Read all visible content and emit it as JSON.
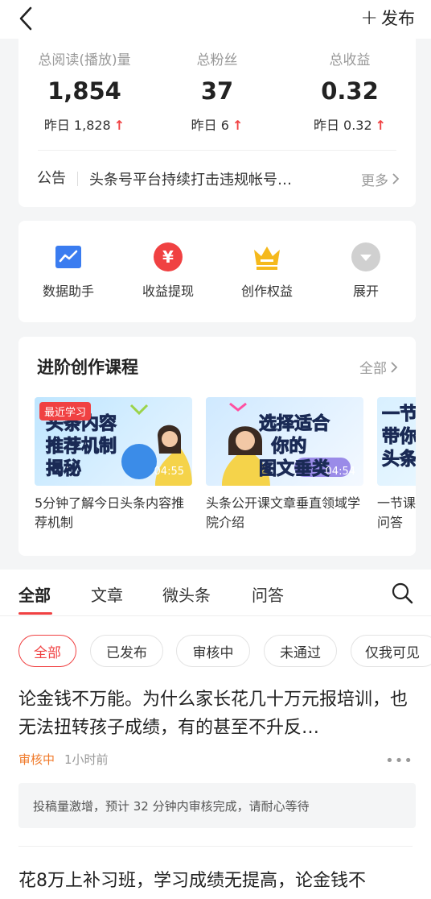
{
  "header": {
    "publish_label": "发布"
  },
  "stats": [
    {
      "label": "总阅读(播放)量",
      "value": "1,854",
      "yesterday": "昨日 1,828"
    },
    {
      "label": "总粉丝",
      "value": "37",
      "yesterday": "昨日 6"
    },
    {
      "label": "总收益",
      "value": "0.32",
      "yesterday": "昨日 0.32"
    }
  ],
  "notice": {
    "label": "公告",
    "text": "头条号平台持续打击违规帐号…",
    "more": "更多"
  },
  "tools": [
    {
      "label": "数据助手",
      "icon": "chart-icon",
      "color": "#3a7cf0"
    },
    {
      "label": "收益提现",
      "icon": "yen-icon",
      "color": "#f04142"
    },
    {
      "label": "创作权益",
      "icon": "crown-icon",
      "color": "#f5b91c"
    },
    {
      "label": "展开",
      "icon": "expand-icon",
      "color": "#cccccc"
    }
  ],
  "courses": {
    "title": "进阶创作课程",
    "all_label": "全部",
    "items": [
      {
        "badge": "最近学习",
        "headline": "头条内容\n推荐机制\n揭秘",
        "duration": "04:55",
        "text": "5分钟了解今日头条内容推荐机制"
      },
      {
        "badge": "",
        "headline": "选择适合\n你的\n图文垂类",
        "duration": "04:54",
        "text": "头条公开课文章垂直领域学院介绍"
      },
      {
        "badge": "",
        "headline": "一节\n带你\n头条",
        "duration": "",
        "text": "一节课问答"
      }
    ]
  },
  "tabs": [
    "全部",
    "文章",
    "微头条",
    "问答"
  ],
  "filters": [
    "全部",
    "已发布",
    "审核中",
    "未通过",
    "仅我可见"
  ],
  "feed": {
    "item1": {
      "title": "论金钱不万能。为什么家长花几十万元报培训，也无法扭转孩子成绩，有的甚至不升反…",
      "status": "审核中",
      "time": "1小时前",
      "review_note": "投稿量激增，预计 32 分钟内审核完成，请耐心等待"
    },
    "item2": {
      "title": "花8万上补习班，学习成绩无提高，论金钱不"
    }
  },
  "colors": {
    "accent": "#f04142",
    "status_pending": "#f07a2a"
  }
}
